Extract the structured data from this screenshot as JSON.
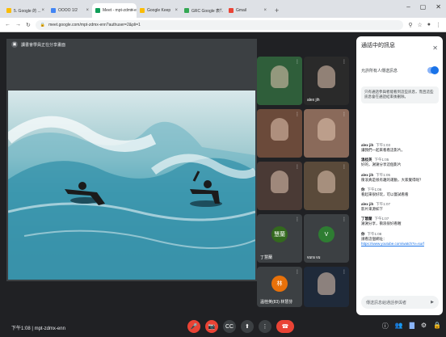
{
  "browser": {
    "tabs": [
      {
        "label": "5. Google 的 ...",
        "fav": "#fbbc04"
      },
      {
        "label": "OOOO 1/2",
        "fav": "#4285f4"
      },
      {
        "label": "Meet - mpt-zdmx-enn",
        "fav": "#0f9d58",
        "active": true
      },
      {
        "label": "Google Keep",
        "fav": "#fbbc04"
      },
      {
        "label": "GRC Google 表...",
        "fav": "#34a853"
      },
      {
        "label": "Gmail",
        "fav": "#ea4335"
      }
    ],
    "new_tab": "+",
    "window_controls": [
      "–",
      "▢",
      "✕"
    ],
    "url": "meet.google.com/mpt-zdmx-enn?authuser=2&pli=1"
  },
  "meeting": {
    "presenter_label": "讀書會學員正在分享畫面",
    "tiles": [
      {
        "name": "",
        "bg": "#2f5e3a"
      },
      {
        "name": "alex jih",
        "bg": "#2a2a2a"
      },
      {
        "name": "",
        "bg": "#6b4a3a"
      },
      {
        "name": "",
        "bg": "#8a6a5a"
      },
      {
        "name": "",
        "bg": "#4a3a35"
      },
      {
        "name": "",
        "bg": "#5a4a3a"
      },
      {
        "name": "丁慧蘭",
        "avatar": "慧蘭",
        "avatar_color": "#33691e",
        "bg": "#3c4043"
      },
      {
        "name": "vura vu",
        "avatar": "V",
        "avatar_color": "#2e7d32",
        "bg": "#3c4043"
      },
      {
        "name": "溫桂英(83) 林慧芬",
        "avatar": "林",
        "avatar_color": "#e8710a",
        "bg": "#3c4043"
      },
      {
        "name": "",
        "bg": "#1f2a3a"
      }
    ],
    "time": "下午1:08",
    "meeting_code": "mpt-zdmx-enn"
  },
  "chat": {
    "title": "通話中的訊息",
    "toggle_label": "允許所有人傳送訊息",
    "notice": "只有通話參與者能看到這些訊息，而且這些訊息會在通話結束後刪除。",
    "messages": [
      {
        "sender": "alex jih",
        "time": "下午1:03",
        "body": "讓我們一起來看看這影片。",
        "link": ""
      },
      {
        "sender": "溫桂英",
        "time": "下午1:05",
        "body": "好的，謝謝分享這個影片",
        "link": ""
      },
      {
        "sender": "alex jih",
        "time": "下午1:05",
        "body": "衝浪真是很有趣的運動，大家覺得呢？",
        "link": ""
      },
      {
        "sender": "你",
        "time": "下午1:06",
        "body": "看起來很好玩，可以嘗試看看",
        "link": ""
      },
      {
        "sender": "alex jih",
        "time": "下午1:07",
        "body": "影片來源如下",
        "link": ""
      },
      {
        "sender": "丁慧蘭",
        "time": "下午1:07",
        "body": "謝謝分享，衝浪很好看喔",
        "link": ""
      },
      {
        "sender": "你",
        "time": "下午1:08",
        "body": "請看這個網址：",
        "link": "https://www.youtube.com/watch?v=surf"
      }
    ],
    "input_placeholder": "傳送訊息給通話參與者",
    "send_icon": "▶"
  },
  "controls": {
    "mic": "🎤",
    "cam": "📷",
    "present": "⬆",
    "captions": "CC",
    "more": "⋮",
    "end": "☎",
    "info": "ⓘ",
    "people": "👥",
    "chat_count": "",
    "activities": "⚙",
    "lock": "🔒"
  }
}
